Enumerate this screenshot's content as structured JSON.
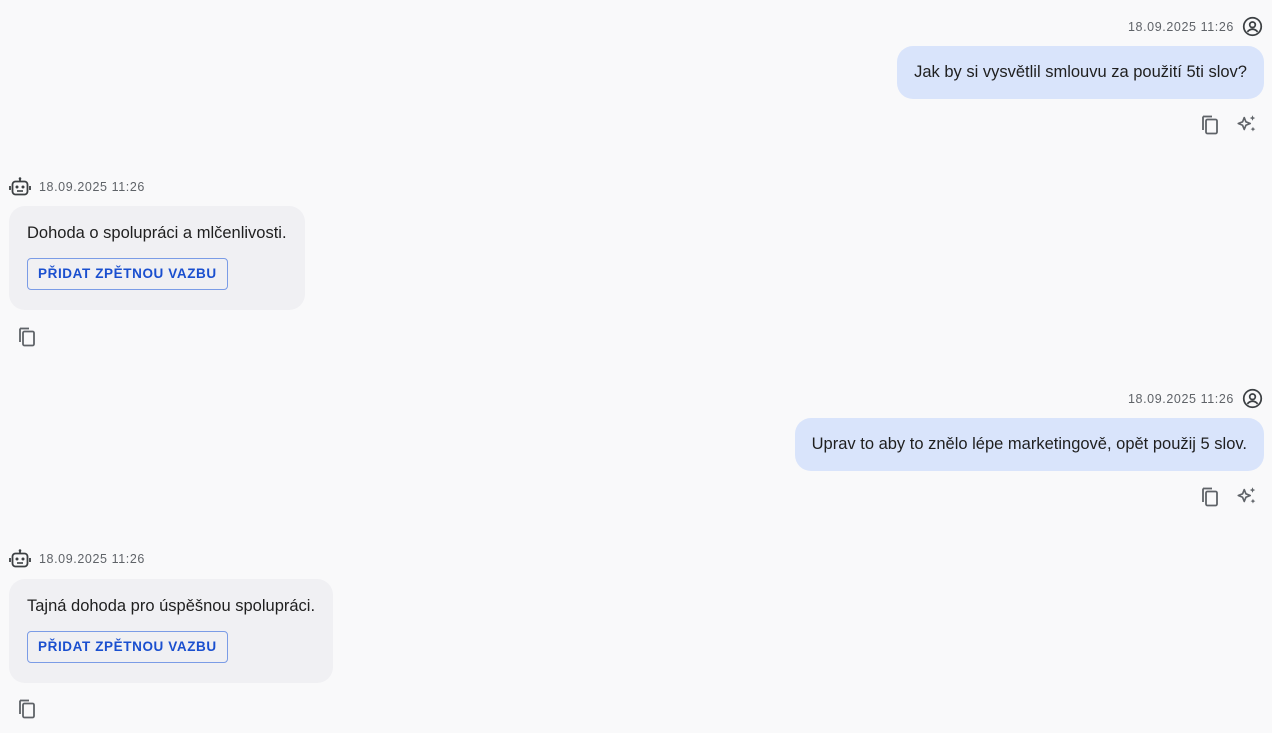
{
  "messages": [
    {
      "role": "user",
      "timestamp": "18.09.2025 11:26",
      "text": "Jak by si vysvětlil smlouvu za použití 5ti slov?",
      "actions": [
        "copy-icon",
        "sparkle-icon"
      ]
    },
    {
      "role": "bot",
      "timestamp": "18.09.2025 11:26",
      "text": "Dohoda o spolupráci a mlčenlivosti.",
      "feedback_label": "PŘIDAT ZPĚTNOU VAZBU",
      "actions": [
        "copy-icon"
      ]
    },
    {
      "role": "user",
      "timestamp": "18.09.2025 11:26",
      "text": "Uprav to aby to znělo lépe marketingově, opět použij 5 slov.",
      "actions": [
        "copy-icon",
        "sparkle-icon"
      ]
    },
    {
      "role": "bot",
      "timestamp": "18.09.2025 11:26",
      "text": "Tajná dohoda pro úspěšnou spolupráci.",
      "feedback_label": "PŘIDAT ZPĚTNOU VAZBU",
      "actions": [
        "copy-icon"
      ]
    }
  ],
  "colors": {
    "background": "#f9f9fa",
    "user_bubble": "#d9e4fb",
    "bot_bubble": "#f0f0f3",
    "accent": "#1a4fcf",
    "meta_text": "#5f6368"
  }
}
